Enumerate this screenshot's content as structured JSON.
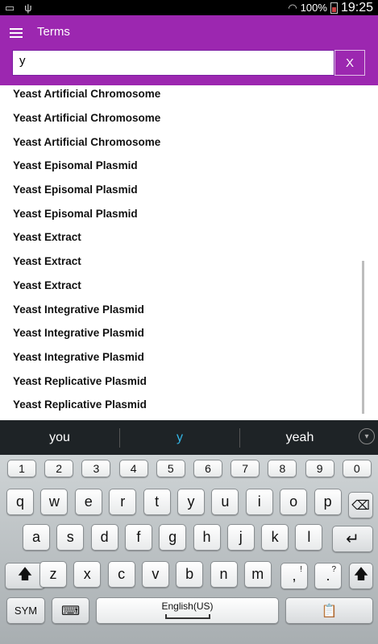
{
  "status": {
    "battery": "100%",
    "time": "19:25"
  },
  "appbar": {
    "title": "Terms",
    "menu_icon": "hamburger-icon"
  },
  "search": {
    "value": "y",
    "clear_label": "X"
  },
  "results": [
    "Yeast Artificial Chromosome",
    "Yeast Artificial Chromosome",
    "Yeast Artificial Chromosome",
    "Yeast Episomal Plasmid",
    "Yeast Episomal Plasmid",
    "Yeast Episomal Plasmid",
    "Yeast Extract",
    "Yeast Extract",
    "Yeast Extract",
    "Yeast Integrative Plasmid",
    "Yeast Integrative Plasmid",
    "Yeast Integrative Plasmid",
    "Yeast Replicative Plasmid",
    "Yeast Replicative Plasmid"
  ],
  "keyboard": {
    "suggestions": [
      "you",
      "y",
      "yeah"
    ],
    "numbers": [
      "1",
      "2",
      "3",
      "4",
      "5",
      "6",
      "7",
      "8",
      "9",
      "0"
    ],
    "row1": [
      "q",
      "w",
      "e",
      "r",
      "t",
      "y",
      "u",
      "i",
      "o",
      "p"
    ],
    "row2": [
      "a",
      "s",
      "d",
      "f",
      "g",
      "h",
      "j",
      "k",
      "l"
    ],
    "row3": [
      "z",
      "x",
      "c",
      "v",
      "b",
      "n",
      "m"
    ],
    "comma_key": ",",
    "comma_sub": "!",
    "period_key": ".",
    "period_sub": "?",
    "sym_label": "SYM",
    "space_label": "English(US)"
  },
  "colors": {
    "accent": "#9c27b0",
    "suggestion_highlight": "#33b5e5"
  }
}
